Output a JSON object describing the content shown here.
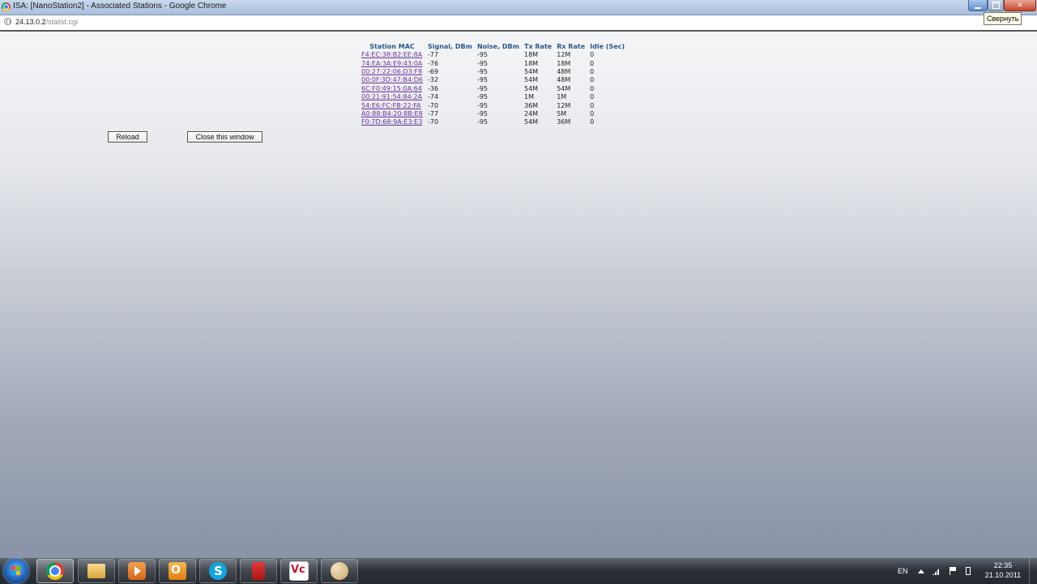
{
  "window": {
    "title": "ISA: [NanoStation2] - Associated Stations - Google Chrome",
    "tooltip": "Свернуть",
    "close_glyph": "✕"
  },
  "address": {
    "host": "24.13.0.2",
    "path": "/stalist.cgi"
  },
  "table": {
    "headers": [
      "Station MAC",
      "Signal, DBm",
      "Noise, DBm",
      "Tx Rate",
      "Rx Rate",
      "Idle (Sec)"
    ],
    "rows": [
      [
        "F4:EC:38:B2:EE:8A",
        "-77",
        "-95",
        "18M",
        "12M",
        "0"
      ],
      [
        "74:EA:3A:E9:43:0A",
        "-76",
        "-95",
        "18M",
        "18M",
        "0"
      ],
      [
        "00:27:22:06:D3:F8",
        "-69",
        "-95",
        "54M",
        "48M",
        "0"
      ],
      [
        "00:0F:3D:47:B4:D6",
        "-32",
        "-95",
        "54M",
        "48M",
        "0"
      ],
      [
        "6C:F0:49:15:0A:64",
        "-36",
        "-95",
        "54M",
        "54M",
        "0"
      ],
      [
        "00:21:91:54:84:2A",
        "-74",
        "-95",
        "1M",
        "1M",
        "0"
      ],
      [
        "54:E6:FC:FB:22:FA",
        "-70",
        "-95",
        "36M",
        "12M",
        "0"
      ],
      [
        "A0:88:B4:20:8B:E8",
        "-77",
        "-95",
        "24M",
        "5M",
        "0"
      ],
      [
        "F0:7D:68:9A:E3:E3",
        "-70",
        "-95",
        "54M",
        "36M",
        "0"
      ]
    ]
  },
  "buttons": {
    "reload": "Reload",
    "close_window": "Close this window"
  },
  "taskbar": {
    "apps": [
      "chrome-icon",
      "folder-icon",
      "media-player-icon",
      "outlook-icon",
      "skype-icon",
      "book-icon",
      "vc-icon",
      "paint-icon"
    ],
    "language": "EN",
    "time": "22:35",
    "date": "21.10.2011"
  },
  "colors": {
    "header_blue": "#2c5a8c",
    "link_purple": "#663399"
  }
}
